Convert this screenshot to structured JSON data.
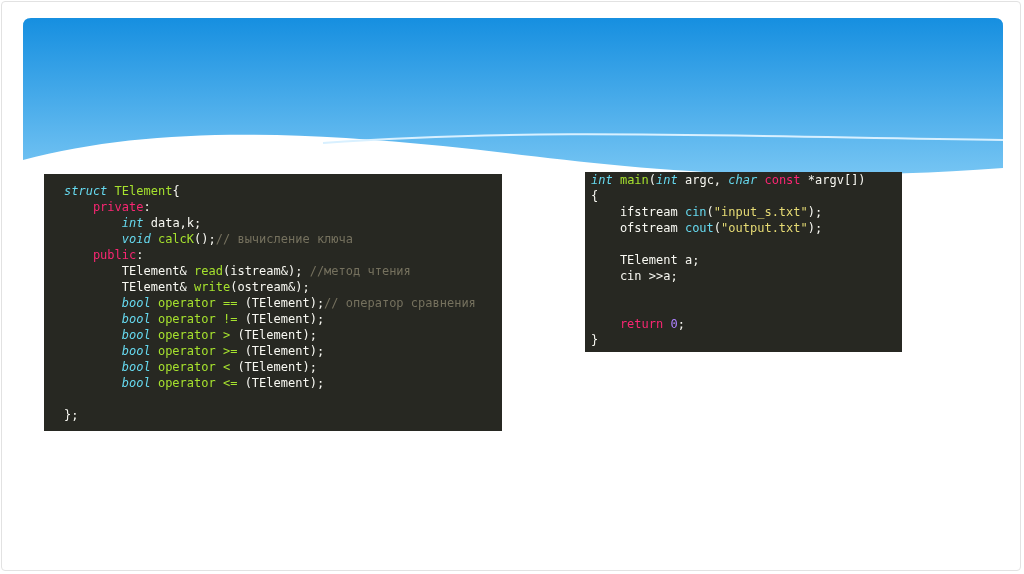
{
  "code_panels": [
    {
      "lines": [
        {
          "tokens": [
            {
              "kind": "type",
              "text": "struct "
            },
            {
              "kind": "name",
              "text": "TElement"
            },
            {
              "kind": "plain",
              "text": "{"
            }
          ]
        },
        {
          "tokens": [
            {
              "kind": "keyword",
              "text": "    private"
            },
            {
              "kind": "plain",
              "text": ":"
            }
          ]
        },
        {
          "tokens": [
            {
              "kind": "type",
              "text": "        int"
            },
            {
              "kind": "plain",
              "text": " data,k;"
            }
          ]
        },
        {
          "tokens": [
            {
              "kind": "type",
              "text": "        void "
            },
            {
              "kind": "name",
              "text": "calcK"
            },
            {
              "kind": "plain",
              "text": "();"
            },
            {
              "kind": "comment",
              "text": "// вычисление ключа"
            }
          ]
        },
        {
          "tokens": [
            {
              "kind": "keyword",
              "text": "    public"
            },
            {
              "kind": "plain",
              "text": ":"
            }
          ]
        },
        {
          "tokens": [
            {
              "kind": "plain",
              "text": "        TElement& "
            },
            {
              "kind": "name",
              "text": "read"
            },
            {
              "kind": "plain",
              "text": "(istream&); "
            },
            {
              "kind": "comment",
              "text": "//метод чтения"
            }
          ]
        },
        {
          "tokens": [
            {
              "kind": "plain",
              "text": "        TElement& "
            },
            {
              "kind": "name",
              "text": "write"
            },
            {
              "kind": "plain",
              "text": "(ostream&);"
            }
          ]
        },
        {
          "tokens": [
            {
              "kind": "type",
              "text": "        bool "
            },
            {
              "kind": "name",
              "text": "operator =="
            },
            {
              "kind": "plain",
              "text": " (TElement);"
            },
            {
              "kind": "comment",
              "text": "// оператор сравнения"
            }
          ]
        },
        {
          "tokens": [
            {
              "kind": "type",
              "text": "        bool "
            },
            {
              "kind": "name",
              "text": "operator !="
            },
            {
              "kind": "plain",
              "text": " (TElement);"
            }
          ]
        },
        {
          "tokens": [
            {
              "kind": "type",
              "text": "        bool "
            },
            {
              "kind": "name",
              "text": "operator >"
            },
            {
              "kind": "plain",
              "text": " (TElement);"
            }
          ]
        },
        {
          "tokens": [
            {
              "kind": "type",
              "text": "        bool "
            },
            {
              "kind": "name",
              "text": "operator >="
            },
            {
              "kind": "plain",
              "text": " (TElement);"
            }
          ]
        },
        {
          "tokens": [
            {
              "kind": "type",
              "text": "        bool "
            },
            {
              "kind": "name",
              "text": "operator <"
            },
            {
              "kind": "plain",
              "text": " (TElement);"
            }
          ]
        },
        {
          "tokens": [
            {
              "kind": "type",
              "text": "        bool "
            },
            {
              "kind": "name",
              "text": "operator <="
            },
            {
              "kind": "plain",
              "text": " (TElement);"
            }
          ]
        },
        {
          "kind": "blank"
        },
        {
          "tokens": [
            {
              "kind": "plain",
              "text": "};"
            }
          ]
        }
      ]
    },
    {
      "lines": [
        {
          "tokens": [
            {
              "kind": "type",
              "text": "int "
            },
            {
              "kind": "name",
              "text": "main"
            },
            {
              "kind": "plain",
              "text": "("
            },
            {
              "kind": "type",
              "text": "int"
            },
            {
              "kind": "plain",
              "text": " argc, "
            },
            {
              "kind": "type",
              "text": "char "
            },
            {
              "kind": "keyword",
              "text": "const"
            },
            {
              "kind": "plain",
              "text": " *argv[])"
            }
          ]
        },
        {
          "tokens": [
            {
              "kind": "plain",
              "text": "{"
            }
          ]
        },
        {
          "tokens": [
            {
              "kind": "plain",
              "text": "    ifstream "
            },
            {
              "kind": "call",
              "text": "cin"
            },
            {
              "kind": "plain",
              "text": "("
            },
            {
              "kind": "string",
              "text": "\"input_s.txt\""
            },
            {
              "kind": "plain",
              "text": ");"
            }
          ]
        },
        {
          "tokens": [
            {
              "kind": "plain",
              "text": "    ofstream "
            },
            {
              "kind": "call",
              "text": "cout"
            },
            {
              "kind": "plain",
              "text": "("
            },
            {
              "kind": "string",
              "text": "\"output.txt\""
            },
            {
              "kind": "plain",
              "text": ");"
            }
          ]
        },
        {
          "kind": "blank"
        },
        {
          "tokens": [
            {
              "kind": "plain",
              "text": "    TElement a;"
            }
          ]
        },
        {
          "tokens": [
            {
              "kind": "plain",
              "text": "    cin >>a;"
            }
          ]
        },
        {
          "kind": "blank"
        },
        {
          "kind": "blank"
        },
        {
          "tokens": [
            {
              "kind": "keyword",
              "text": "    return "
            },
            {
              "kind": "number",
              "text": "0"
            },
            {
              "kind": "plain",
              "text": ";"
            }
          ]
        },
        {
          "tokens": [
            {
              "kind": "plain",
              "text": "}"
            }
          ]
        }
      ]
    }
  ]
}
